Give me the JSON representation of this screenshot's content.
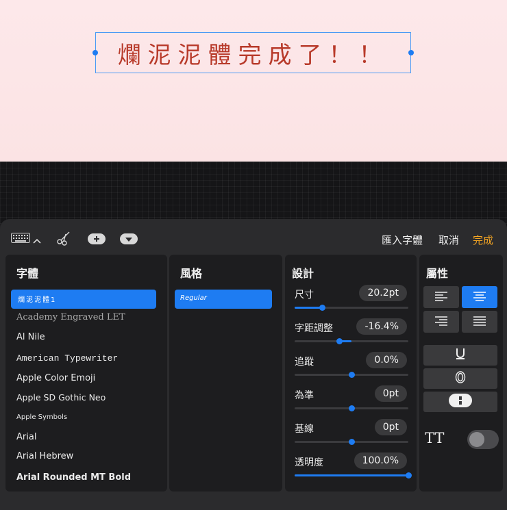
{
  "canvas": {
    "text": "爛泥泥體完成了！！"
  },
  "toolbar": {
    "import_label": "匯入字體",
    "cancel_label": "取消",
    "done_label": "完成"
  },
  "fonts": {
    "title": "字體",
    "items": [
      {
        "label": "爛泥泥體1",
        "selected": true
      },
      {
        "label": "Academy Engraved LET"
      },
      {
        "label": "Al Nile"
      },
      {
        "label": "American Typewriter"
      },
      {
        "label": "Apple Color Emoji"
      },
      {
        "label": "Apple SD Gothic Neo"
      },
      {
        "label": "Apple Symbols"
      },
      {
        "label": "Arial"
      },
      {
        "label": "Arial Hebrew"
      },
      {
        "label": "Arial Rounded MT Bold"
      }
    ]
  },
  "style": {
    "title": "風格",
    "items": [
      {
        "label": "Regular",
        "selected": true
      }
    ]
  },
  "design": {
    "title": "設計",
    "rows": [
      {
        "label": "尺寸",
        "value": "20.2pt",
        "level": 0.24
      },
      {
        "label": "字距調整",
        "value": "-16.4%",
        "level": 0.39
      },
      {
        "label": "追蹤",
        "value": "0.0%",
        "level": 0.5
      },
      {
        "label": "為準",
        "value": "0pt",
        "level": 0.5
      },
      {
        "label": "基線",
        "value": "0pt",
        "level": 0.5
      },
      {
        "label": "透明度",
        "value": "100.0%",
        "level": 1.0
      }
    ]
  },
  "attributes": {
    "title": "屬性",
    "caps_label": "TT",
    "caps_enabled": false
  },
  "colors": {
    "accent": "#1e7cf2",
    "done": "#f5a623",
    "text_red": "#b83a2a"
  }
}
